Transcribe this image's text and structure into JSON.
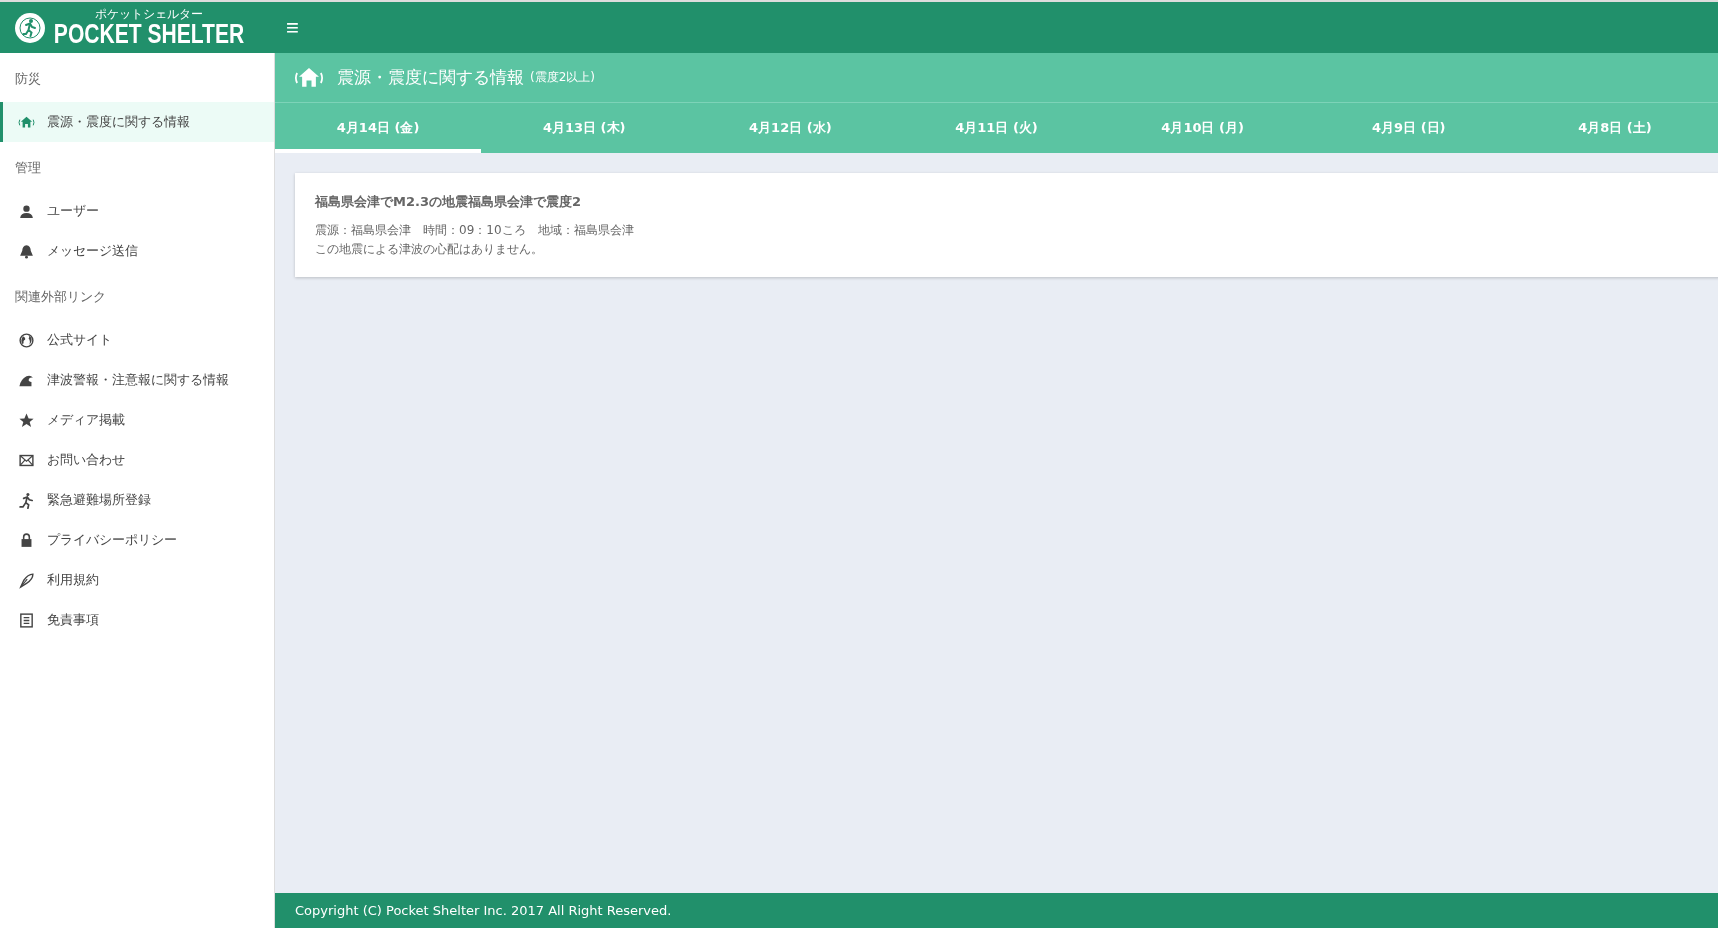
{
  "header": {
    "logo_kana": "ポケットシェルター",
    "logo_text": "POCKET SHELTER",
    "menu_icon": "≡"
  },
  "sidebar": {
    "sections": [
      {
        "title": "防災",
        "items": [
          {
            "label": "震源・震度に関する情報",
            "kind": "quake",
            "selected": true
          }
        ]
      },
      {
        "title": "管理",
        "items": [
          {
            "label": "ユーザー",
            "kind": "user",
            "selected": false
          },
          {
            "label": "メッセージ送信",
            "kind": "bell",
            "selected": false
          }
        ]
      },
      {
        "title": "関連外部リンク",
        "items": [
          {
            "label": "公式サイト",
            "kind": "globe",
            "selected": false
          },
          {
            "label": "津波警報・注意報に関する情報",
            "kind": "wave",
            "selected": false
          },
          {
            "label": "メディア掲載",
            "kind": "star",
            "selected": false
          },
          {
            "label": "お問い合わせ",
            "kind": "mail",
            "selected": false
          },
          {
            "label": "緊急避難場所登録",
            "kind": "run",
            "selected": false
          },
          {
            "label": "プライバシーポリシー",
            "kind": "lock",
            "selected": false
          },
          {
            "label": "利用規約",
            "kind": "pen",
            "selected": false
          },
          {
            "label": "免責事項",
            "kind": "list",
            "selected": false
          }
        ]
      }
    ]
  },
  "page": {
    "title": "震源・震度に関する情報",
    "subtitle": "(震度2以上)"
  },
  "tabs": [
    {
      "label": "4月14日 (金)",
      "selected": true
    },
    {
      "label": "4月13日 (木)",
      "selected": false
    },
    {
      "label": "4月12日 (水)",
      "selected": false
    },
    {
      "label": "4月11日 (火)",
      "selected": false
    },
    {
      "label": "4月10日 (月)",
      "selected": false
    },
    {
      "label": "4月9日 (日)",
      "selected": false
    },
    {
      "label": "4月8日 (土)",
      "selected": false
    }
  ],
  "events": [
    {
      "title": "福島県会津でM2.3の地震福島県会津で震度2",
      "details": "震源：福島県会津　時間：09：10ころ　地域：福島県会津",
      "note": "この地震による津波の心配はありません。"
    }
  ],
  "footer": {
    "copyright": "Copyright (C) Pocket Shelter Inc. 2017 All Right Reserved."
  }
}
